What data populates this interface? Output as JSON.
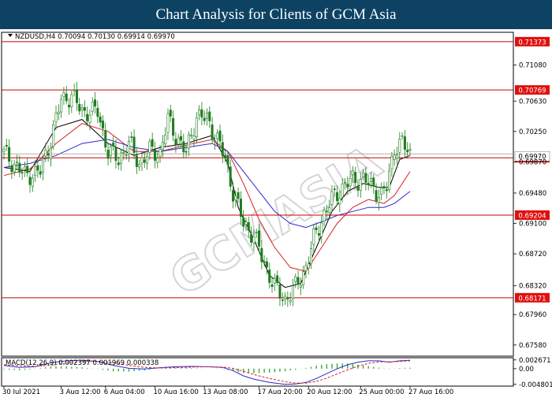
{
  "banner": {
    "title": "Chart Analysis for Clients of GCM Asia"
  },
  "watermark": {
    "text": "GCMASIA"
  },
  "colors": {
    "banner_bg": "#0d4263",
    "candle": "#1e7d1e",
    "level_line": "#cc0000",
    "level_label_bg": "#e01010",
    "ma_fast": "#000000",
    "ma_mid": "#d62020",
    "ma_slow": "#2a2ad0",
    "macd_hist": "#3aa83a",
    "macd_line": "#1f2fd0",
    "macd_signal": "#e02020"
  },
  "chart_data": [
    {
      "type": "candlestick",
      "symbol_header": "NZDUSD,H4  0.70094 0.70130 0.69914 0.69970",
      "ylim": [
        0.6745,
        0.7148
      ],
      "y_ticks": [
        "0.71080",
        "0.70630",
        "0.70250",
        "0.69870",
        "0.69480",
        "0.69100",
        "0.68720",
        "0.68320",
        "0.67960",
        "0.67580"
      ],
      "x_labels": [
        "30 Jul 2021",
        "3 Aug 12:00",
        "6 Aug 04:00",
        "10 Aug 16:00",
        "13 Aug 08:00",
        "17 Aug 20:00",
        "20 Aug 12:00",
        "25 Aug 00:00",
        "27 Aug 16:00"
      ],
      "x_label_positions": [
        0,
        22,
        39,
        58,
        77,
        98,
        117,
        137,
        156
      ],
      "levels": [
        {
          "value": 0.71373,
          "label": "0.71373"
        },
        {
          "value": 0.70769,
          "label": "0.70769"
        },
        {
          "value": 0.69921,
          "label": "0.69921"
        },
        {
          "value": 0.69204,
          "label": "0.69204"
        },
        {
          "value": 0.68171,
          "label": "0.68171"
        }
      ],
      "current_price": {
        "value": 0.6997,
        "label": "0.69970"
      },
      "close_trace": [
        [
          0,
          0.6998
        ],
        [
          8,
          0.697
        ],
        [
          14,
          0.6975
        ],
        [
          18,
          0.7015
        ],
        [
          22,
          0.7065
        ],
        [
          26,
          0.707
        ],
        [
          30,
          0.705
        ],
        [
          36,
          0.705
        ],
        [
          40,
          0.7
        ],
        [
          44,
          0.699
        ],
        [
          48,
          0.701
        ],
        [
          52,
          0.6985
        ],
        [
          56,
          0.7
        ],
        [
          60,
          0.6998
        ],
        [
          63,
          0.704
        ],
        [
          66,
          0.702
        ],
        [
          70,
          0.6998
        ],
        [
          74,
          0.7045
        ],
        [
          78,
          0.704
        ],
        [
          82,
          0.7015
        ],
        [
          85,
          0.699
        ],
        [
          88,
          0.695
        ],
        [
          92,
          0.691
        ],
        [
          96,
          0.6895
        ],
        [
          100,
          0.686
        ],
        [
          104,
          0.683
        ],
        [
          108,
          0.6815
        ],
        [
          112,
          0.683
        ],
        [
          116,
          0.6855
        ],
        [
          119,
          0.689
        ],
        [
          122,
          0.6915
        ],
        [
          126,
          0.694
        ],
        [
          130,
          0.6955
        ],
        [
          134,
          0.6965
        ],
        [
          138,
          0.6965
        ],
        [
          142,
          0.6955
        ],
        [
          145,
          0.6945
        ],
        [
          147,
          0.6955
        ],
        [
          150,
          0.7005
        ],
        [
          153,
          0.701
        ],
        [
          156,
          0.6997
        ]
      ],
      "moving_averages": [
        {
          "name": "",
          "points": [
            [
              0,
              0.698
            ],
            [
              10,
              0.6975
            ],
            [
              20,
              0.703
            ],
            [
              30,
              0.704
            ],
            [
              40,
              0.701
            ],
            [
              50,
              0.6995
            ],
            [
              60,
              0.7005
            ],
            [
              70,
              0.701
            ],
            [
              80,
              0.702
            ],
            [
              86,
              0.6985
            ],
            [
              90,
              0.693
            ],
            [
              96,
              0.689
            ],
            [
              102,
              0.6845
            ],
            [
              108,
              0.683
            ],
            [
              114,
              0.6835
            ],
            [
              120,
              0.688
            ],
            [
              126,
              0.6925
            ],
            [
              132,
              0.695
            ],
            [
              138,
              0.696
            ],
            [
              144,
              0.6955
            ],
            [
              148,
              0.6955
            ],
            [
              152,
              0.699
            ],
            [
              156,
              0.6995
            ]
          ]
        },
        {
          "name": "",
          "points": [
            [
              0,
              0.697
            ],
            [
              10,
              0.6978
            ],
            [
              20,
              0.701
            ],
            [
              30,
              0.7035
            ],
            [
              40,
              0.7025
            ],
            [
              50,
              0.7
            ],
            [
              60,
              0.7
            ],
            [
              70,
              0.7008
            ],
            [
              80,
              0.7015
            ],
            [
              86,
              0.7
            ],
            [
              92,
              0.696
            ],
            [
              98,
              0.6915
            ],
            [
              104,
              0.688
            ],
            [
              110,
              0.6855
            ],
            [
              116,
              0.685
            ],
            [
              122,
              0.688
            ],
            [
              128,
              0.691
            ],
            [
              134,
              0.693
            ],
            [
              140,
              0.694
            ],
            [
              146,
              0.6935
            ],
            [
              150,
              0.6945
            ],
            [
              156,
              0.6975
            ]
          ]
        },
        {
          "name": "",
          "points": [
            [
              0,
              0.698
            ],
            [
              10,
              0.6985
            ],
            [
              20,
              0.6995
            ],
            [
              30,
              0.701
            ],
            [
              40,
              0.7015
            ],
            [
              50,
              0.7005
            ],
            [
              60,
              0.7
            ],
            [
              70,
              0.7005
            ],
            [
              80,
              0.701
            ],
            [
              86,
              0.7
            ],
            [
              92,
              0.6975
            ],
            [
              98,
              0.695
            ],
            [
              104,
              0.6925
            ],
            [
              110,
              0.691
            ],
            [
              116,
              0.6905
            ],
            [
              122,
              0.6912
            ],
            [
              128,
              0.692
            ],
            [
              134,
              0.6925
            ],
            [
              140,
              0.693
            ],
            [
              146,
              0.693
            ],
            [
              150,
              0.6935
            ],
            [
              156,
              0.695
            ]
          ]
        }
      ]
    },
    {
      "type": "macd",
      "header": "MACD(12,26,9)  0.002397  0.001969  0.000338",
      "ylim": [
        -0.0051,
        0.0031
      ],
      "y_ticks": [
        "0.002671",
        "0.00",
        "-0.004801"
      ],
      "macd_line": [
        [
          0,
          0.001
        ],
        [
          6,
          0.0004
        ],
        [
          12,
          0.0006
        ],
        [
          18,
          0.0018
        ],
        [
          24,
          0.0024
        ],
        [
          30,
          0.0026
        ],
        [
          36,
          0.0022
        ],
        [
          42,
          0.001
        ],
        [
          48,
          0.0001
        ],
        [
          54,
          -0.0001
        ],
        [
          60,
          0.0003
        ],
        [
          66,
          0.0006
        ],
        [
          72,
          0.0007
        ],
        [
          78,
          0.0006
        ],
        [
          84,
          0.0004
        ],
        [
          88,
          -0.0006
        ],
        [
          92,
          -0.0022
        ],
        [
          96,
          -0.0032
        ],
        [
          102,
          -0.0042
        ],
        [
          108,
          -0.0048
        ],
        [
          112,
          -0.0047
        ],
        [
          116,
          -0.0042
        ],
        [
          120,
          -0.003
        ],
        [
          124,
          -0.0015
        ],
        [
          128,
          0.0
        ],
        [
          132,
          0.0012
        ],
        [
          136,
          0.002
        ],
        [
          140,
          0.0024
        ],
        [
          144,
          0.0024
        ],
        [
          148,
          0.002
        ],
        [
          152,
          0.0024
        ],
        [
          156,
          0.0026
        ]
      ],
      "signal_line": [
        [
          0,
          0.0012
        ],
        [
          6,
          0.0009
        ],
        [
          12,
          0.0007
        ],
        [
          18,
          0.0011
        ],
        [
          24,
          0.0017
        ],
        [
          30,
          0.0022
        ],
        [
          36,
          0.0023
        ],
        [
          42,
          0.0018
        ],
        [
          48,
          0.001
        ],
        [
          54,
          0.0004
        ],
        [
          60,
          0.0002
        ],
        [
          66,
          0.0003
        ],
        [
          72,
          0.0005
        ],
        [
          78,
          0.0006
        ],
        [
          84,
          0.0005
        ],
        [
          88,
          0.0001
        ],
        [
          92,
          -0.0008
        ],
        [
          96,
          -0.0018
        ],
        [
          102,
          -0.003
        ],
        [
          108,
          -0.004
        ],
        [
          112,
          -0.0044
        ],
        [
          116,
          -0.0044
        ],
        [
          120,
          -0.0039
        ],
        [
          124,
          -0.0029
        ],
        [
          128,
          -0.0016
        ],
        [
          132,
          -0.0004
        ],
        [
          136,
          0.0008
        ],
        [
          140,
          0.0016
        ],
        [
          144,
          0.0021
        ],
        [
          148,
          0.0021
        ],
        [
          152,
          0.0022
        ],
        [
          156,
          0.0024
        ]
      ],
      "histogram": [
        [
          0,
          -0.0002
        ],
        [
          6,
          -0.0005
        ],
        [
          12,
          -0.0001
        ],
        [
          18,
          0.0007
        ],
        [
          24,
          0.0007
        ],
        [
          30,
          0.0004
        ],
        [
          36,
          -0.0001
        ],
        [
          42,
          -0.0008
        ],
        [
          48,
          -0.0009
        ],
        [
          54,
          -0.0005
        ],
        [
          60,
          0.0001
        ],
        [
          66,
          0.0003
        ],
        [
          72,
          0.0002
        ],
        [
          78,
          0.0
        ],
        [
          84,
          -0.0001
        ],
        [
          88,
          -0.0007
        ],
        [
          92,
          -0.0014
        ],
        [
          96,
          -0.0014
        ],
        [
          102,
          -0.0012
        ],
        [
          108,
          -0.0008
        ],
        [
          112,
          -0.0003
        ],
        [
          116,
          0.0002
        ],
        [
          120,
          0.0009
        ],
        [
          124,
          0.0014
        ],
        [
          128,
          0.0016
        ],
        [
          132,
          0.0016
        ],
        [
          136,
          0.0012
        ],
        [
          140,
          0.0008
        ],
        [
          144,
          0.0003
        ],
        [
          148,
          -0.0001
        ],
        [
          152,
          0.0002
        ],
        [
          156,
          0.0003
        ]
      ]
    }
  ]
}
